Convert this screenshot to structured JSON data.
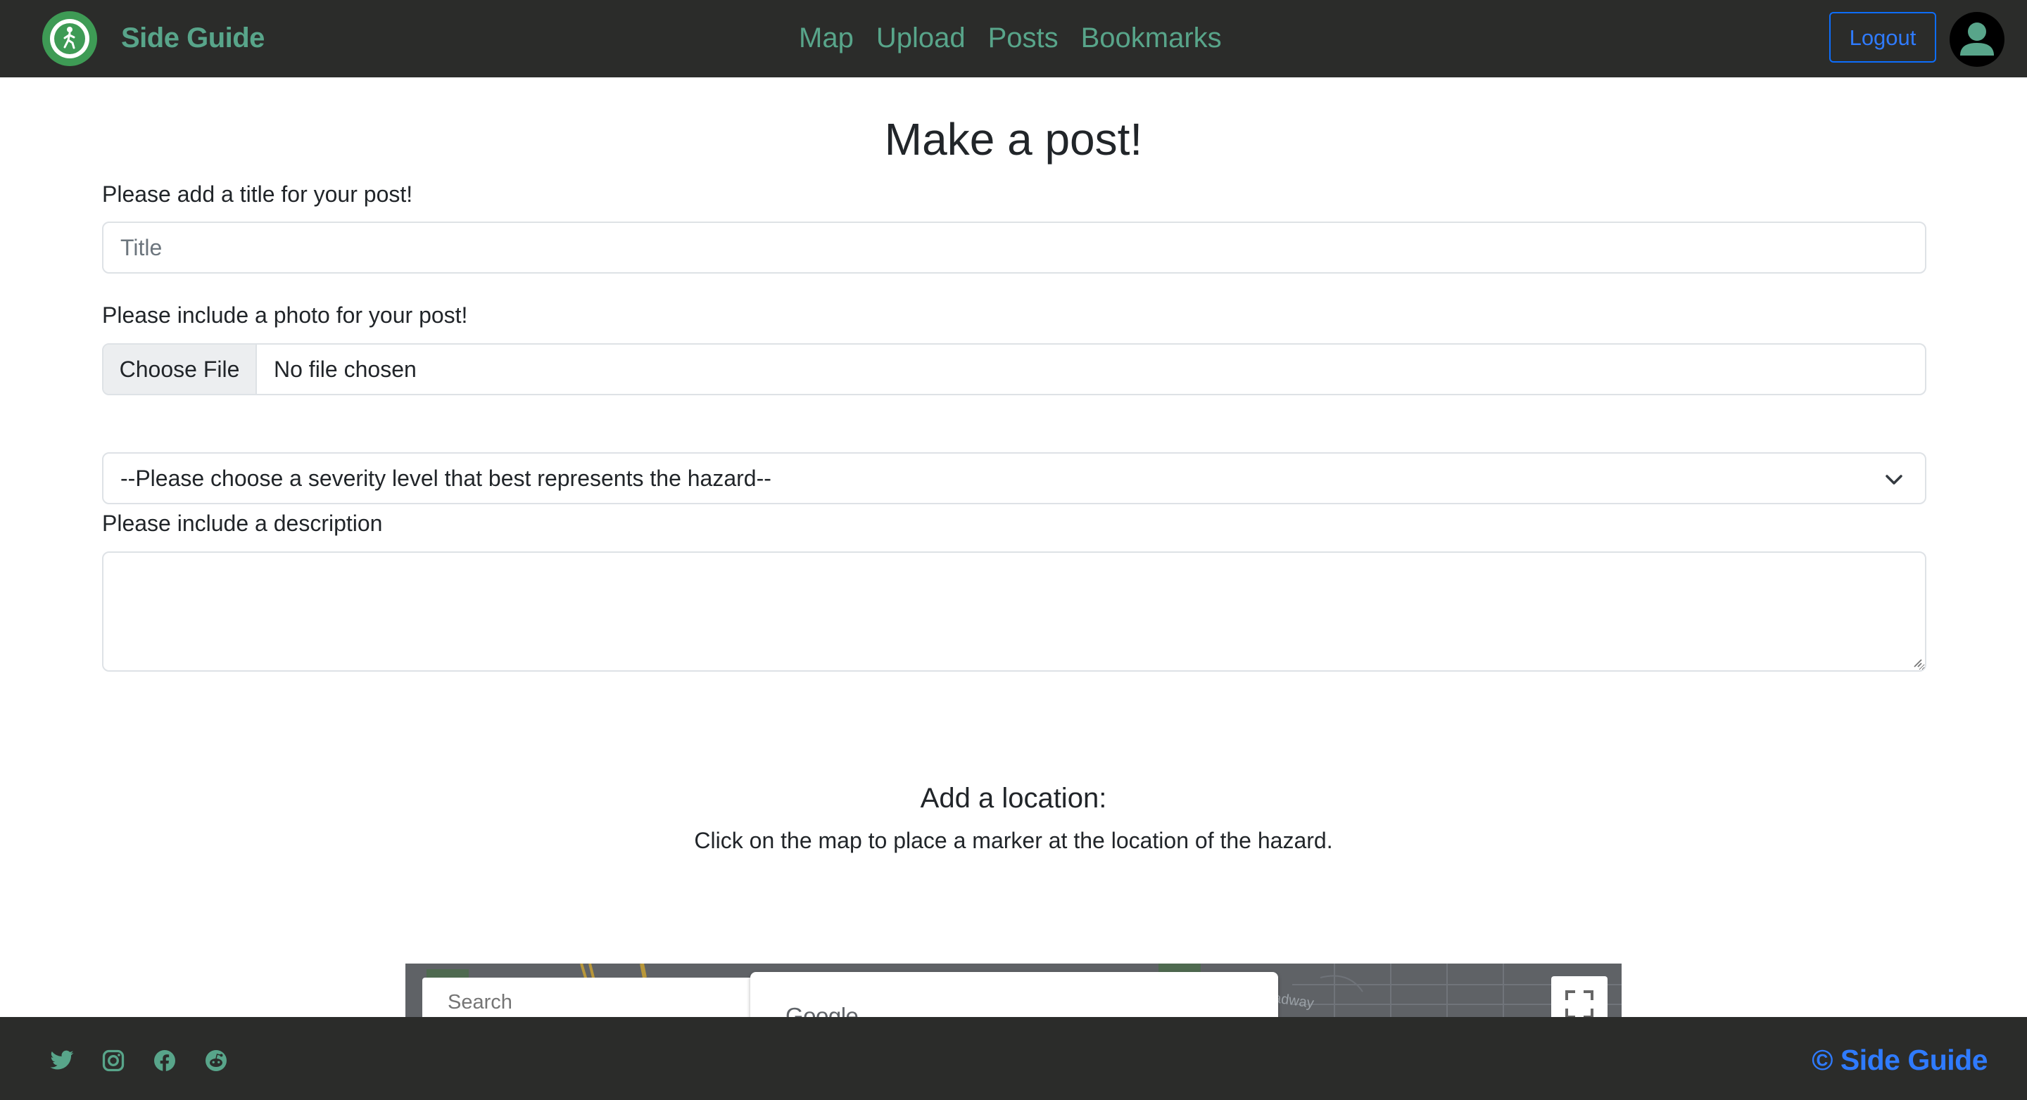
{
  "nav": {
    "brand": "Side Guide",
    "links": [
      "Map",
      "Upload",
      "Posts",
      "Bookmarks"
    ],
    "logout_label": "Logout"
  },
  "form": {
    "page_title": "Make a post!",
    "title_label": "Please add a title for your post!",
    "title_placeholder": "Title",
    "title_value": "",
    "photo_label": "Please include a photo for your post!",
    "file_button_label": "Choose File",
    "file_status": "No file chosen",
    "severity_selected": "--Please choose a severity level that best represents the hazard--",
    "description_label": "Please include a description",
    "description_value": ""
  },
  "location": {
    "heading": "Add a location:",
    "instruction": "Click on the map to place a marker at the location of the hazard."
  },
  "map": {
    "search_placeholder": "Search",
    "provider_text": "Google",
    "road_label": "adway"
  },
  "footer": {
    "social_icons": [
      "twitter-icon",
      "instagram-icon",
      "facebook-icon",
      "reddit-icon"
    ],
    "copyright": "© Side Guide"
  },
  "colors": {
    "navbar_bg": "#2b2c2a",
    "brand_green": "#58a58a",
    "logo_green": "#3e9b55",
    "primary_blue": "#0d6efd"
  }
}
